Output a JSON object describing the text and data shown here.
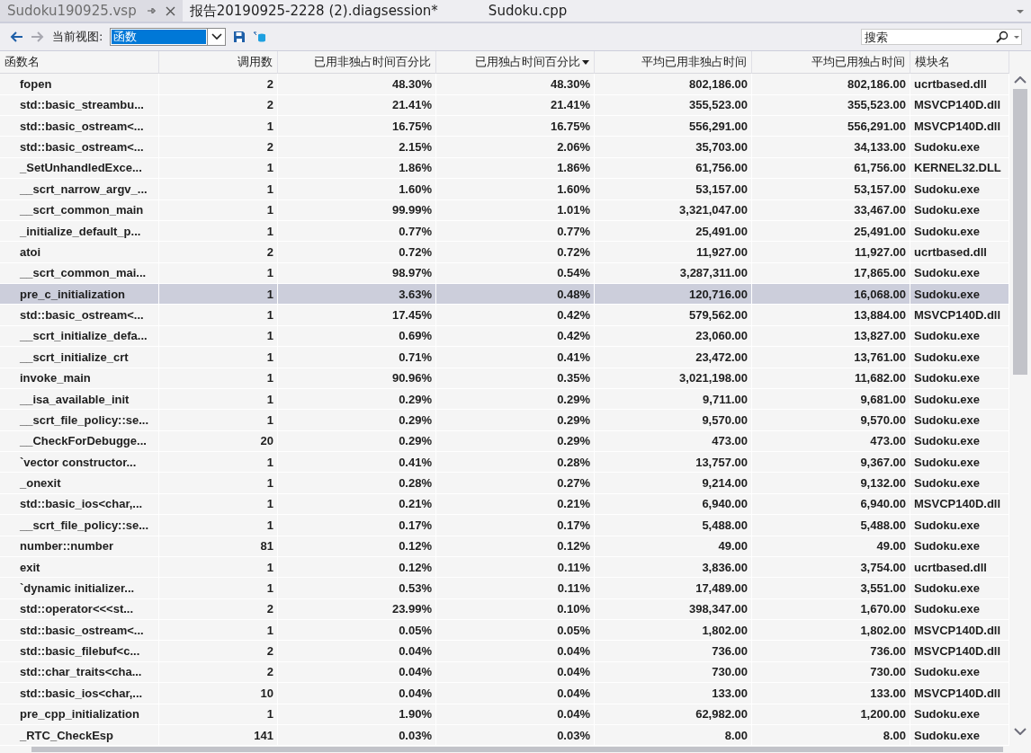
{
  "tabs": [
    {
      "label": "Sudoku190925.vsp",
      "selected": true
    },
    {
      "label": "报告20190925-2228 (2).diagsession*",
      "selected": false
    },
    {
      "label": "Sudoku.cpp",
      "selected": false
    }
  ],
  "toolbar": {
    "view_label": "当前视图:",
    "view_value": "函数",
    "search": {
      "placeholder": "搜索"
    }
  },
  "table": {
    "columns": [
      {
        "label": "函数名",
        "sorted": false
      },
      {
        "label": "调用数",
        "sorted": false
      },
      {
        "label": "已用非独占时间百分比",
        "sorted": false
      },
      {
        "label": "已用独占时间百分比",
        "sorted": true
      },
      {
        "label": "平均已用非独占时间",
        "sorted": false
      },
      {
        "label": "平均已用独占时间",
        "sorted": false
      },
      {
        "label": "模块名",
        "sorted": false
      }
    ],
    "rows": [
      {
        "cells": [
          "fopen",
          "2",
          "48.30%",
          "48.30%",
          "802,186.00",
          "802,186.00",
          "ucrtbased.dll"
        ],
        "selected": false
      },
      {
        "cells": [
          "std::basic_streambu...",
          "2",
          "21.41%",
          "21.41%",
          "355,523.00",
          "355,523.00",
          "MSVCP140D.dll"
        ],
        "selected": false
      },
      {
        "cells": [
          "std::basic_ostream<...",
          "1",
          "16.75%",
          "16.75%",
          "556,291.00",
          "556,291.00",
          "MSVCP140D.dll"
        ],
        "selected": false
      },
      {
        "cells": [
          "std::basic_ostream<...",
          "2",
          "2.15%",
          "2.06%",
          "35,703.00",
          "34,133.00",
          "Sudoku.exe"
        ],
        "selected": false
      },
      {
        "cells": [
          "_SetUnhandledExce...",
          "1",
          "1.86%",
          "1.86%",
          "61,756.00",
          "61,756.00",
          "KERNEL32.DLL"
        ],
        "selected": false
      },
      {
        "cells": [
          "__scrt_narrow_argv_...",
          "1",
          "1.60%",
          "1.60%",
          "53,157.00",
          "53,157.00",
          "Sudoku.exe"
        ],
        "selected": false
      },
      {
        "cells": [
          "__scrt_common_main",
          "1",
          "99.99%",
          "1.01%",
          "3,321,047.00",
          "33,467.00",
          "Sudoku.exe"
        ],
        "selected": false
      },
      {
        "cells": [
          "_initialize_default_p...",
          "1",
          "0.77%",
          "0.77%",
          "25,491.00",
          "25,491.00",
          "Sudoku.exe"
        ],
        "selected": false
      },
      {
        "cells": [
          "atoi",
          "2",
          "0.72%",
          "0.72%",
          "11,927.00",
          "11,927.00",
          "ucrtbased.dll"
        ],
        "selected": false
      },
      {
        "cells": [
          "__scrt_common_mai...",
          "1",
          "98.97%",
          "0.54%",
          "3,287,311.00",
          "17,865.00",
          "Sudoku.exe"
        ],
        "selected": false
      },
      {
        "cells": [
          "pre_c_initialization",
          "1",
          "3.63%",
          "0.48%",
          "120,716.00",
          "16,068.00",
          "Sudoku.exe"
        ],
        "selected": true
      },
      {
        "cells": [
          "std::basic_ostream<...",
          "1",
          "17.45%",
          "0.42%",
          "579,562.00",
          "13,884.00",
          "MSVCP140D.dll"
        ],
        "selected": false
      },
      {
        "cells": [
          "__scrt_initialize_defa...",
          "1",
          "0.69%",
          "0.42%",
          "23,060.00",
          "13,827.00",
          "Sudoku.exe"
        ],
        "selected": false
      },
      {
        "cells": [
          "__scrt_initialize_crt",
          "1",
          "0.71%",
          "0.41%",
          "23,472.00",
          "13,761.00",
          "Sudoku.exe"
        ],
        "selected": false
      },
      {
        "cells": [
          "invoke_main",
          "1",
          "90.96%",
          "0.35%",
          "3,021,198.00",
          "11,682.00",
          "Sudoku.exe"
        ],
        "selected": false
      },
      {
        "cells": [
          "__isa_available_init",
          "1",
          "0.29%",
          "0.29%",
          "9,711.00",
          "9,681.00",
          "Sudoku.exe"
        ],
        "selected": false
      },
      {
        "cells": [
          "__scrt_file_policy::se...",
          "1",
          "0.29%",
          "0.29%",
          "9,570.00",
          "9,570.00",
          "Sudoku.exe"
        ],
        "selected": false
      },
      {
        "cells": [
          "__CheckForDebugge...",
          "20",
          "0.29%",
          "0.29%",
          "473.00",
          "473.00",
          "Sudoku.exe"
        ],
        "selected": false
      },
      {
        "cells": [
          "`vector constructor...",
          "1",
          "0.41%",
          "0.28%",
          "13,757.00",
          "9,367.00",
          "Sudoku.exe"
        ],
        "selected": false
      },
      {
        "cells": [
          "_onexit",
          "1",
          "0.28%",
          "0.27%",
          "9,214.00",
          "9,132.00",
          "Sudoku.exe"
        ],
        "selected": false
      },
      {
        "cells": [
          "std::basic_ios<char,...",
          "1",
          "0.21%",
          "0.21%",
          "6,940.00",
          "6,940.00",
          "MSVCP140D.dll"
        ],
        "selected": false
      },
      {
        "cells": [
          "__scrt_file_policy::se...",
          "1",
          "0.17%",
          "0.17%",
          "5,488.00",
          "5,488.00",
          "Sudoku.exe"
        ],
        "selected": false
      },
      {
        "cells": [
          "number::number",
          "81",
          "0.12%",
          "0.12%",
          "49.00",
          "49.00",
          "Sudoku.exe"
        ],
        "selected": false
      },
      {
        "cells": [
          "exit",
          "1",
          "0.12%",
          "0.11%",
          "3,836.00",
          "3,754.00",
          "ucrtbased.dll"
        ],
        "selected": false
      },
      {
        "cells": [
          "`dynamic initializer...",
          "1",
          "0.53%",
          "0.11%",
          "17,489.00",
          "3,551.00",
          "Sudoku.exe"
        ],
        "selected": false
      },
      {
        "cells": [
          "std::operator<<<st...",
          "2",
          "23.99%",
          "0.10%",
          "398,347.00",
          "1,670.00",
          "Sudoku.exe"
        ],
        "selected": false
      },
      {
        "cells": [
          "std::basic_ostream<...",
          "1",
          "0.05%",
          "0.05%",
          "1,802.00",
          "1,802.00",
          "MSVCP140D.dll"
        ],
        "selected": false
      },
      {
        "cells": [
          "std::basic_filebuf<c...",
          "2",
          "0.04%",
          "0.04%",
          "736.00",
          "736.00",
          "MSVCP140D.dll"
        ],
        "selected": false
      },
      {
        "cells": [
          "std::char_traits<cha...",
          "2",
          "0.04%",
          "0.04%",
          "730.00",
          "730.00",
          "Sudoku.exe"
        ],
        "selected": false
      },
      {
        "cells": [
          "std::basic_ios<char,...",
          "10",
          "0.04%",
          "0.04%",
          "133.00",
          "133.00",
          "MSVCP140D.dll"
        ],
        "selected": false
      },
      {
        "cells": [
          "pre_cpp_initialization",
          "1",
          "1.90%",
          "0.04%",
          "62,982.00",
          "1,200.00",
          "Sudoku.exe"
        ],
        "selected": false
      },
      {
        "cells": [
          "_RTC_CheckEsp",
          "141",
          "0.03%",
          "0.03%",
          "8.00",
          "8.00",
          "Sudoku.exe"
        ],
        "selected": false
      }
    ]
  }
}
